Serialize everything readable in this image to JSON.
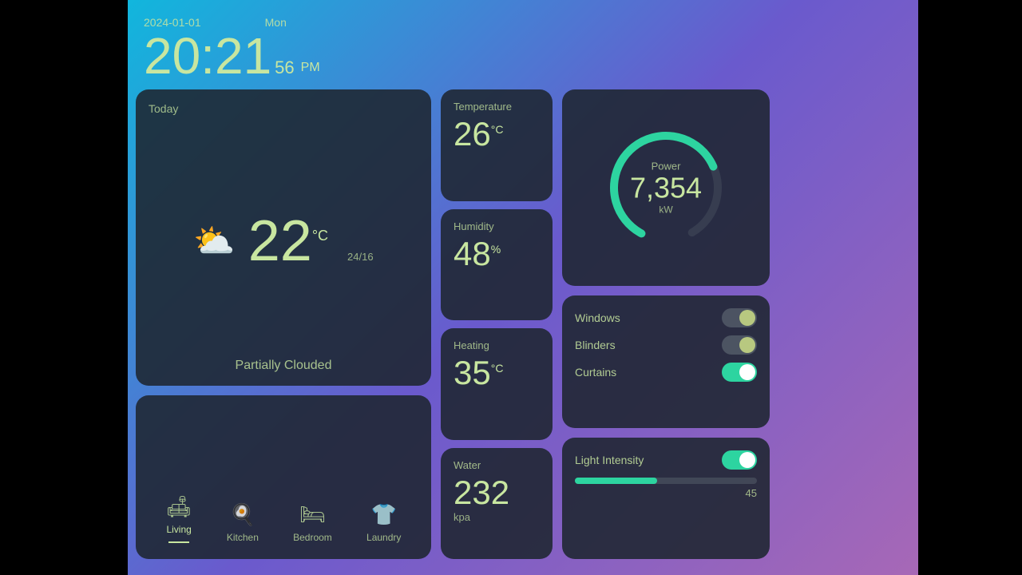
{
  "datetime": {
    "date": "2024-01-01",
    "day": "Mon",
    "hours": "20:21",
    "seconds": "56",
    "ampm": "PM"
  },
  "weather": {
    "today_label": "Today",
    "temperature": "22",
    "temp_unit": "°C",
    "temp_range": "24/16",
    "description": "Partially Clouded",
    "icon": "⛅"
  },
  "rooms": [
    {
      "id": "living",
      "label": "Living",
      "icon": "🛋",
      "active": true
    },
    {
      "id": "kitchen",
      "label": "Kitchen",
      "icon": "🍳",
      "active": false
    },
    {
      "id": "bedroom",
      "label": "Bedroom",
      "icon": "🛏",
      "active": false
    },
    {
      "id": "laundry",
      "label": "Laundry",
      "icon": "👕",
      "active": false
    }
  ],
  "sensors": {
    "temperature": {
      "label": "Temperature",
      "value": "26",
      "unit": "°C"
    },
    "humidity": {
      "label": "Humidity",
      "value": "48",
      "unit": "%"
    },
    "heating": {
      "label": "Heating",
      "value": "35",
      "unit": "°C"
    },
    "water": {
      "label": "Water",
      "value": "232",
      "unit": "kpa"
    }
  },
  "power": {
    "label": "Power",
    "value": "7,354",
    "unit": "kW",
    "percent": 72
  },
  "controls": {
    "title": "Windows Blinders Curtains",
    "items": [
      {
        "name": "Windows",
        "state": "on-dim"
      },
      {
        "name": "Blinders",
        "state": "on-dim"
      },
      {
        "name": "Curtains",
        "state": "on-green"
      }
    ]
  },
  "light_intensity": {
    "label": "Light Intensity",
    "value": 45,
    "max": 100,
    "state": "on-green"
  },
  "accent_color": "#2dd4a0",
  "text_color": "#c8e6a0"
}
